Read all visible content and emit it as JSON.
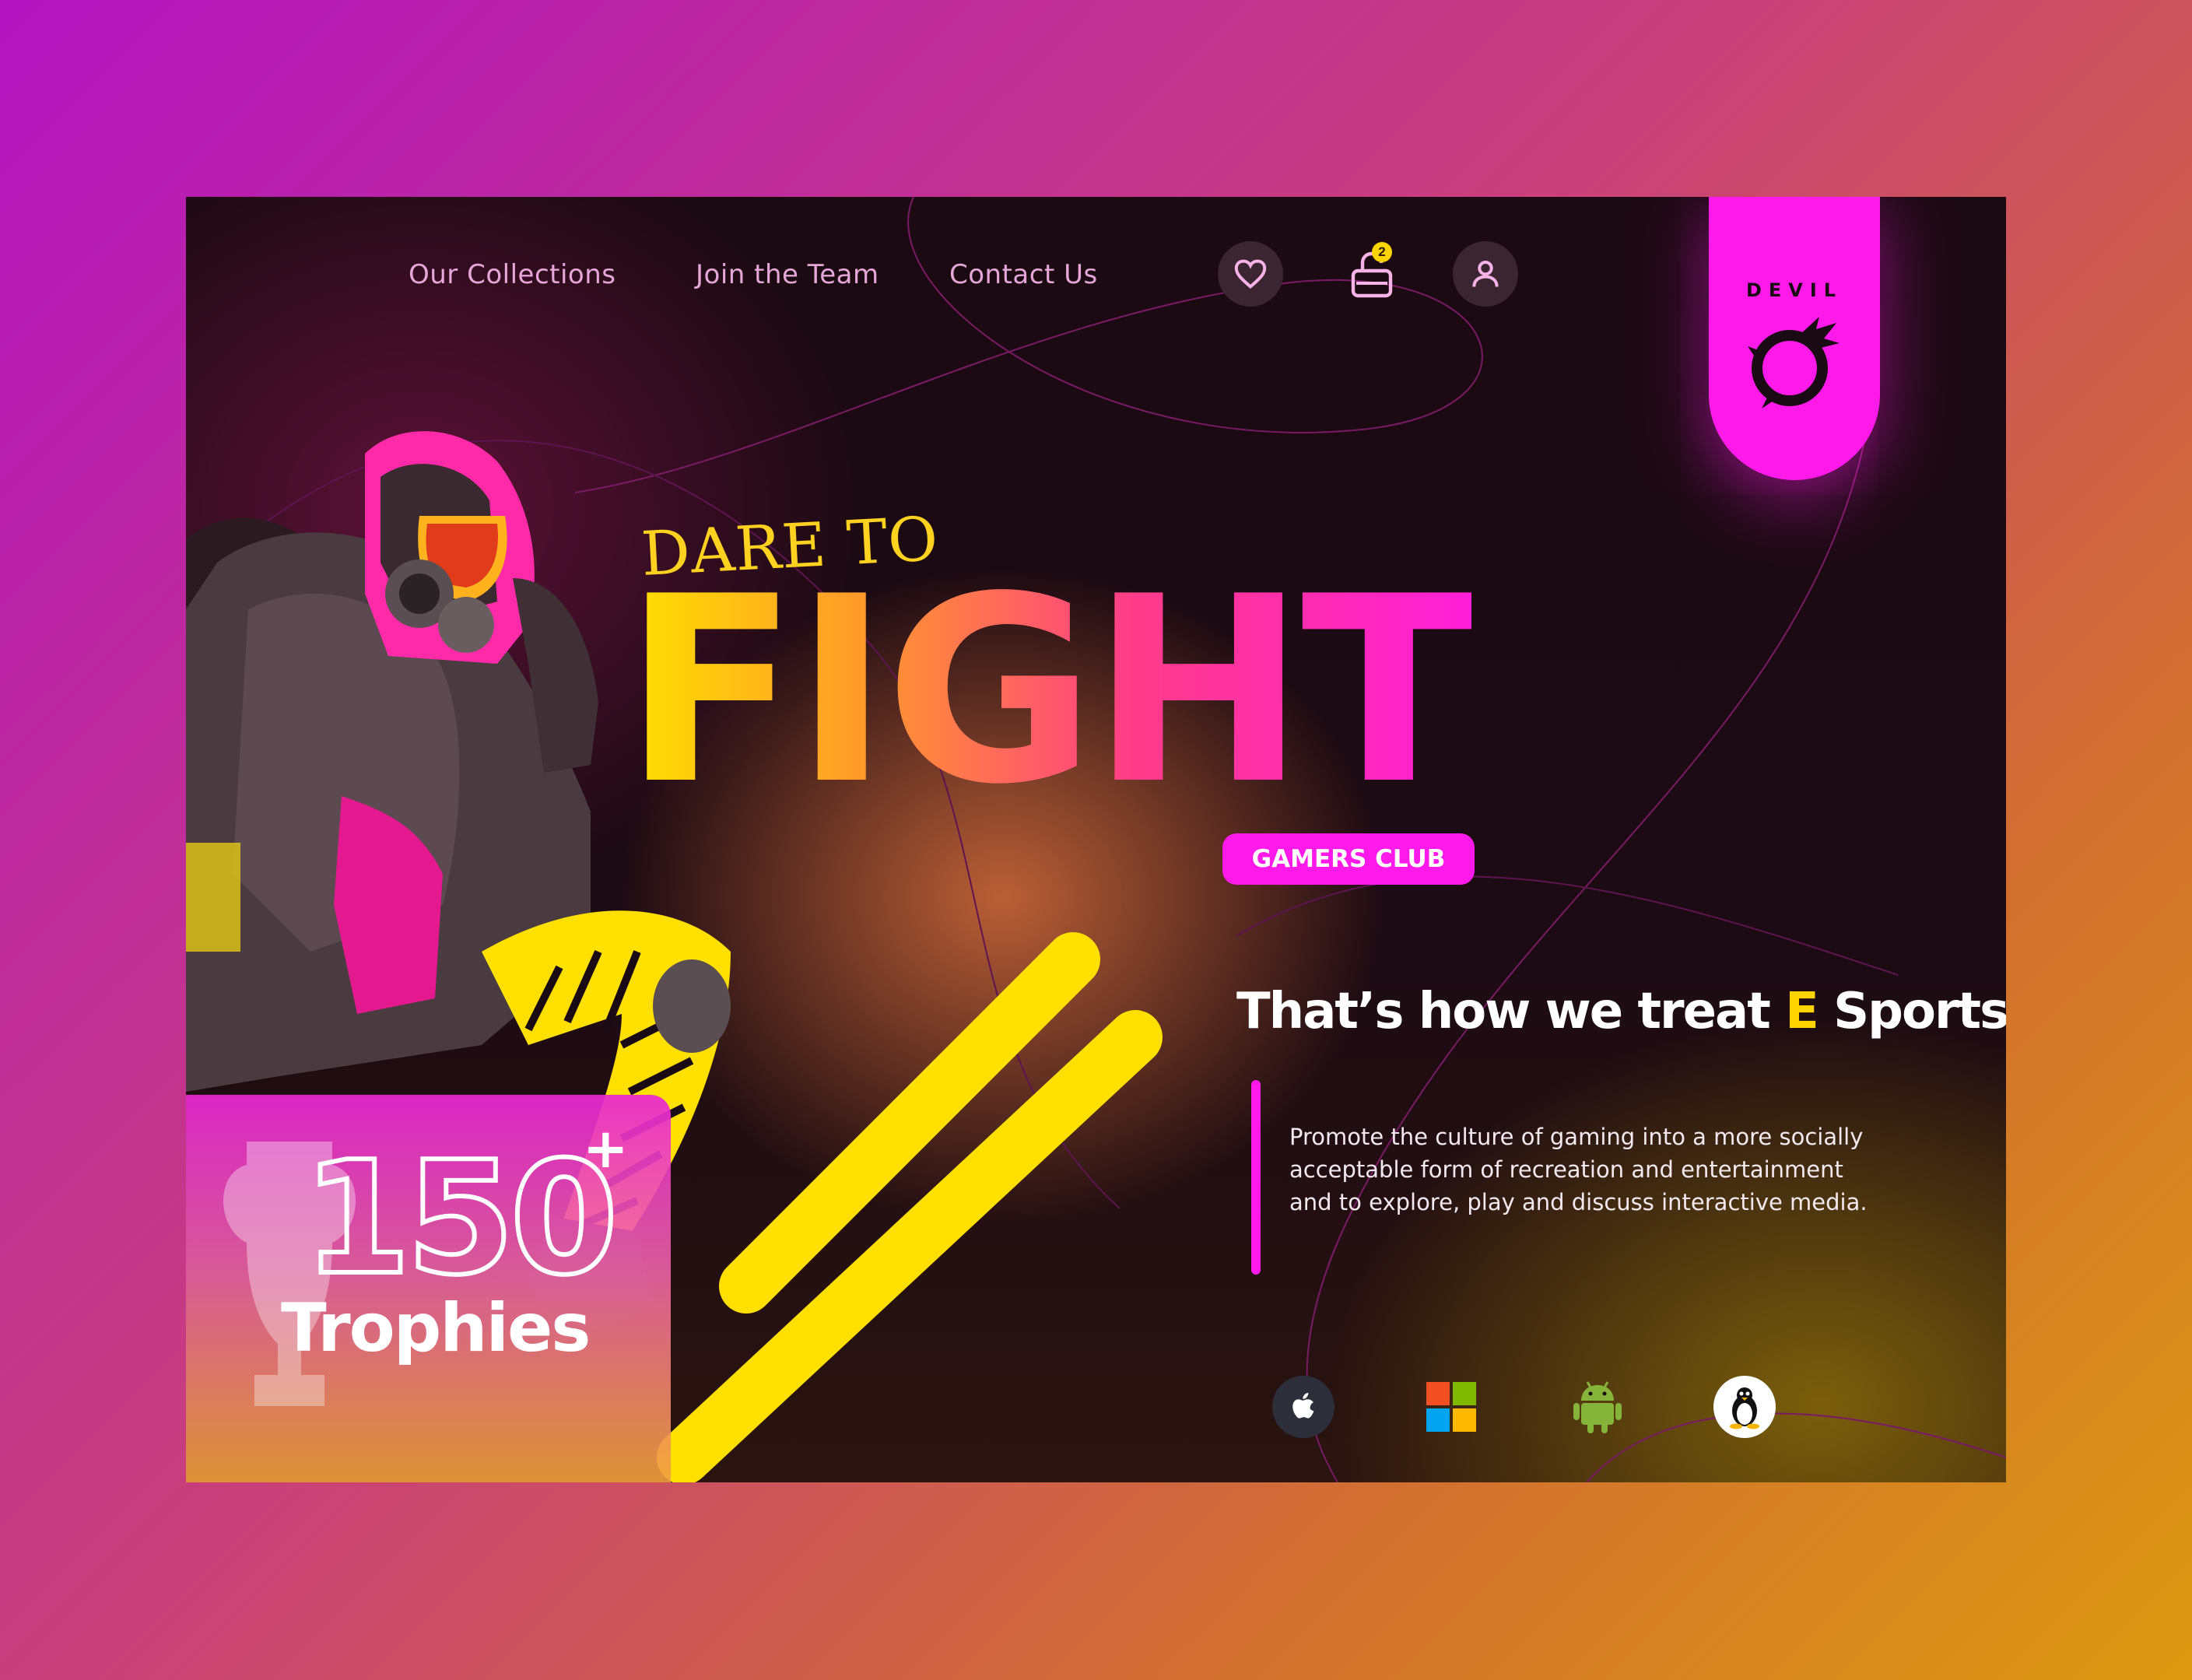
{
  "nav": {
    "links": [
      "Our Collections",
      "Join the Team",
      "Contact Us"
    ],
    "icons": [
      "heart-icon",
      "lock-bag-icon",
      "user-icon"
    ],
    "cart_count": "2"
  },
  "logo": {
    "text": "DEVIL",
    "icon": "dragon-ouroboros-icon"
  },
  "hero": {
    "pre_title": "DARE TO",
    "title": "FIGHT",
    "pill": "GAMERS CLUB",
    "tagline_part1": "That’s how we treat ",
    "tagline_highlight": "E",
    "tagline_part2": " Sports",
    "description": "Promote the culture of gaming into a more socially acceptable form of recreation and entertainment and to explore, play and discuss interactive media."
  },
  "stats": {
    "count": "150",
    "plus": "+",
    "label": "Trophies"
  },
  "platforms": [
    "apple-icon",
    "windows-icon",
    "android-icon",
    "linux-icon"
  ],
  "colors": {
    "accent": "#ff1aea",
    "highlight": "#ffd400",
    "background": "#1c0a12"
  }
}
